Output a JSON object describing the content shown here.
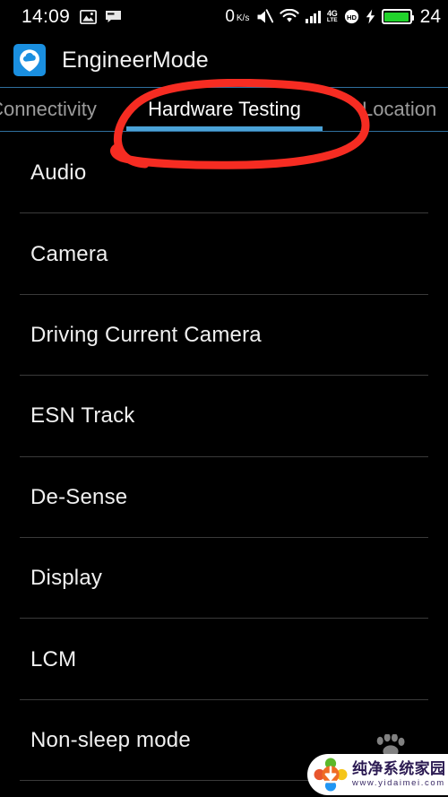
{
  "status_bar": {
    "clock": "14:09",
    "left_icons": [
      {
        "name": "photo-icon"
      },
      {
        "name": "screenshot-icon"
      }
    ],
    "network_speed_value": "0",
    "network_speed_unit": "K/s",
    "icons": [
      {
        "name": "mute-icon"
      },
      {
        "name": "wifi-icon"
      },
      {
        "name": "signal-bars-icon"
      },
      {
        "name": "volte-4g-icon"
      },
      {
        "name": "hd-call-icon"
      },
      {
        "name": "charging-bolt-icon"
      },
      {
        "name": "battery-icon"
      }
    ],
    "lte_label_top": "4G",
    "lte_label_bottom": "LTE",
    "hd_label": "HD",
    "battery_percent": "24"
  },
  "app_bar": {
    "icon_name": "engineermode-app-icon",
    "title": "EngineerMode"
  },
  "tabs": {
    "items": [
      {
        "label": "Connectivity",
        "active": false
      },
      {
        "label": "Hardware Testing",
        "active": true
      },
      {
        "label": "Location",
        "active": false
      }
    ],
    "active_index": 1,
    "active_underline_color": "#4ba3d8",
    "divider_color": "#2f6f9e"
  },
  "list": {
    "items": [
      {
        "label": "Audio"
      },
      {
        "label": "Camera"
      },
      {
        "label": "Driving Current Camera"
      },
      {
        "label": "ESN Track"
      },
      {
        "label": "De-Sense"
      },
      {
        "label": "Display"
      },
      {
        "label": "LCM"
      },
      {
        "label": "Non-sleep mode"
      }
    ]
  },
  "annotation": {
    "name": "red-circle-annotation",
    "color": "#f62c22",
    "targets_tab": "Hardware Testing"
  },
  "watermark": {
    "title": "纯净系统家园",
    "url": "www.yidaimei.com",
    "paw_icon": "paw-print-icon",
    "logo_icon": "flower-download-logo"
  },
  "colors": {
    "background": "#000000",
    "text_primary": "#f0f0f0",
    "text_inactive_tab": "#9b9b9b",
    "accent_blue": "#4ba3d8",
    "app_icon_blue": "#1a8fe0",
    "divider": "#3a3a3a",
    "battery_green": "#21d32b",
    "annotation_red": "#f62c22"
  }
}
